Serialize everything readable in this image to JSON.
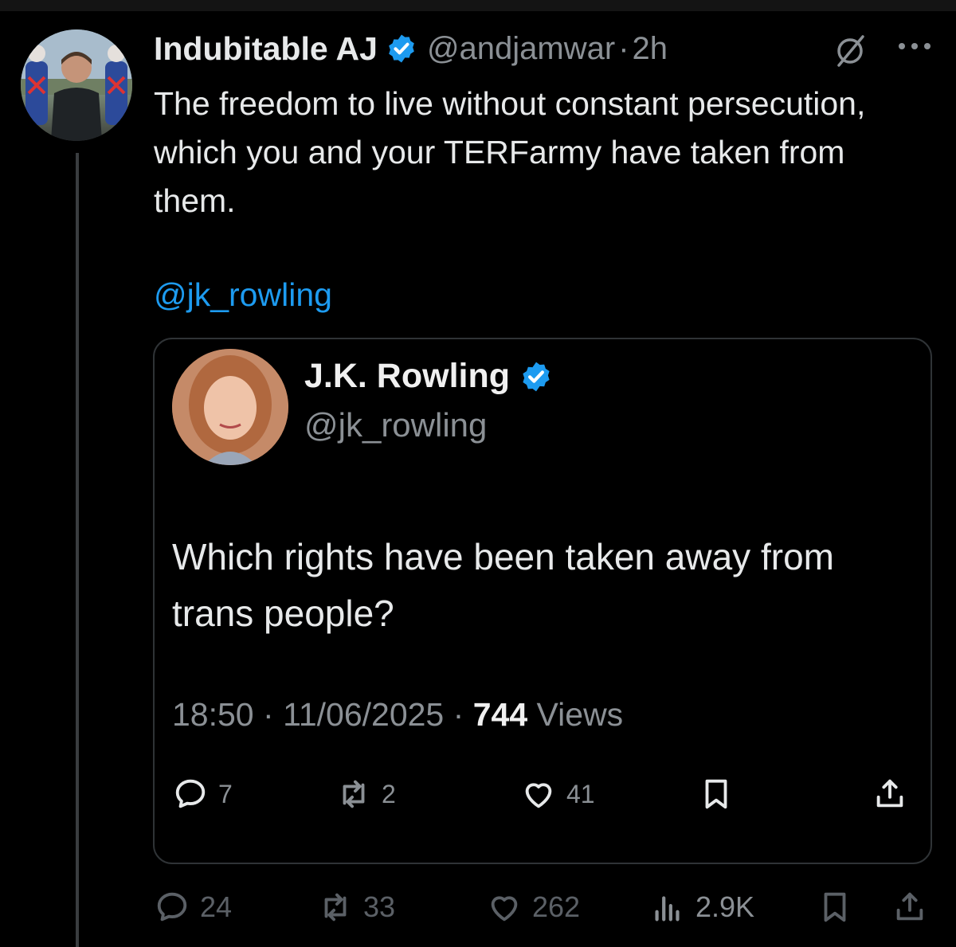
{
  "colors": {
    "background": "#000000",
    "text": "#e7e9ea",
    "muted": "#8b9095",
    "accent": "#1d9bf0",
    "verified": "#1d9bf0"
  },
  "post": {
    "author_name": "Indubitable AJ",
    "handle": "@andjamwar",
    "separator": "·",
    "time": "2h",
    "text": "The freedom to live without constant persecution, which you and your TERFarmy have taken from them.",
    "mention": "@jk_rowling",
    "icons": [
      "verified-badge-icon",
      "grok-icon",
      "more-icon"
    ],
    "actions": {
      "replies": "24",
      "reposts": "33",
      "likes": "262",
      "views": "2.9K"
    }
  },
  "quote": {
    "author_name": "J.K. Rowling",
    "handle": "@jk_rowling",
    "text": "Which rights have been taken away from trans people?",
    "time": "18:50",
    "separator": "·",
    "date": "11/06/2025",
    "views_count": "744",
    "views_label": "Views",
    "actions": {
      "replies": "7",
      "reposts": "2",
      "likes": "41"
    }
  }
}
